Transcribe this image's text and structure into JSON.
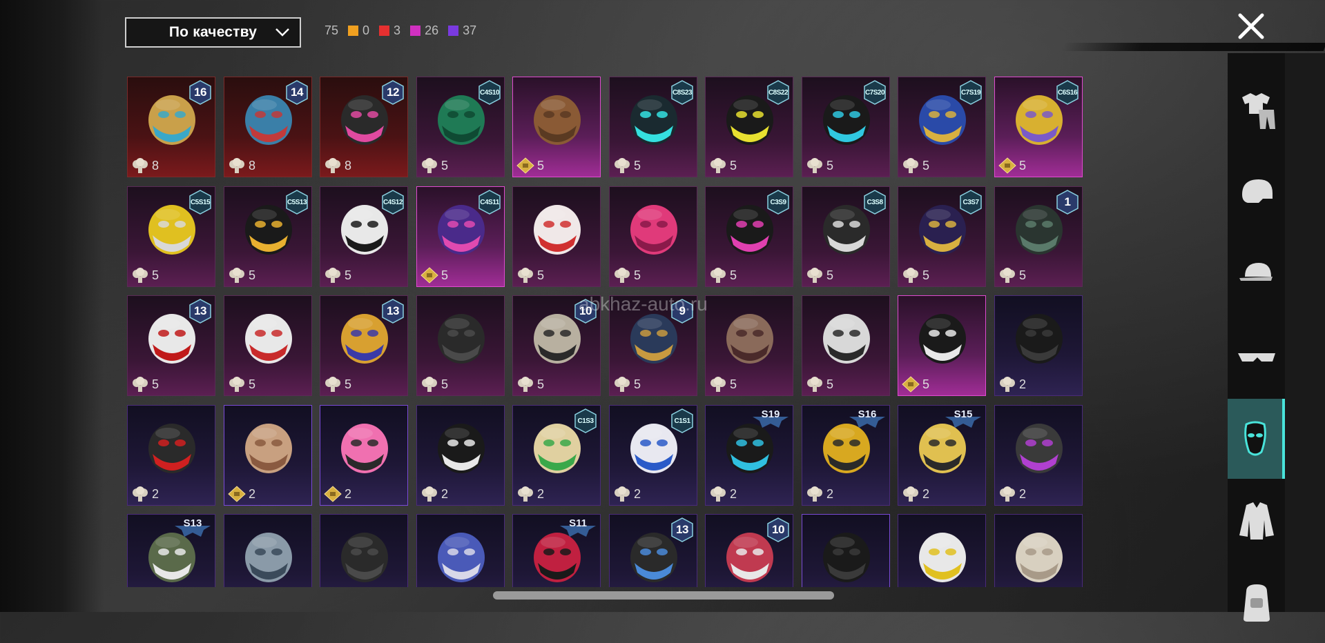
{
  "sort": {
    "label": "По качеству"
  },
  "counts": {
    "total": "75",
    "items": [
      {
        "color": "#f0a020",
        "value": "0"
      },
      {
        "color": "#e53030",
        "value": "3"
      },
      {
        "color": "#d030c0",
        "value": "26"
      },
      {
        "color": "#7a3ae0",
        "value": "37"
      }
    ]
  },
  "watermark": "abkhaz-auto.ru",
  "close_icon": "close-icon",
  "categories": [
    {
      "name": "outfit",
      "icon": "shirt-pants-icon"
    },
    {
      "name": "helmet",
      "icon": "helmet-icon"
    },
    {
      "name": "hat",
      "icon": "cap-icon"
    },
    {
      "name": "glasses",
      "icon": "glasses-icon"
    },
    {
      "name": "mask",
      "icon": "mask-icon",
      "active": true
    },
    {
      "name": "jacket",
      "icon": "jacket-icon"
    },
    {
      "name": "backpack",
      "icon": "backpack-icon"
    }
  ],
  "rows": [
    [
      {
        "q": "red",
        "badge": "16",
        "bt": "num",
        "price": "8",
        "cur": "bp",
        "art": "gold-blue-helmet-mask"
      },
      {
        "q": "red",
        "badge": "14",
        "bt": "num",
        "price": "8",
        "cur": "bp",
        "art": "blue-robot-mask"
      },
      {
        "q": "red",
        "badge": "12",
        "bt": "num",
        "price": "8",
        "cur": "bp",
        "art": "black-pink-mask"
      },
      {
        "q": "pink",
        "badge": "C4S10",
        "bt": "hex",
        "price": "5",
        "cur": "bp",
        "art": "green-face-mask"
      },
      {
        "q": "legendary",
        "badge": "",
        "bt": "",
        "price": "5",
        "cur": "ag",
        "art": "brown-bandana"
      },
      {
        "q": "pink",
        "badge": "C8S23",
        "bt": "hex",
        "price": "5",
        "cur": "bp",
        "art": "cyan-neon-mask"
      },
      {
        "q": "pink",
        "badge": "C8S22",
        "bt": "hex",
        "price": "5",
        "cur": "bp",
        "art": "black-yellow-mask"
      },
      {
        "q": "pink",
        "badge": "C7S20",
        "bt": "hex",
        "price": "5",
        "cur": "bp",
        "art": "black-cyan-mask"
      },
      {
        "q": "pink",
        "badge": "C7S19",
        "bt": "hex",
        "price": "5",
        "cur": "bp",
        "art": "blue-gold-mask"
      },
      {
        "q": "legendary",
        "badge": "C6S16",
        "bt": "hex",
        "price": "5",
        "cur": "ag",
        "art": "yellow-gas-mask"
      }
    ],
    [
      {
        "q": "pink",
        "badge": "C5S15",
        "bt": "hex",
        "price": "5",
        "cur": "bp",
        "art": "yellow-respirator"
      },
      {
        "q": "pink",
        "badge": "C5S13",
        "bt": "hex",
        "price": "5",
        "cur": "bp",
        "art": "graffiti-mask"
      },
      {
        "q": "pink",
        "badge": "C4S12",
        "bt": "hex",
        "price": "5",
        "cur": "bp",
        "art": "white-teeth-mask"
      },
      {
        "q": "legendary",
        "badge": "C4S11",
        "bt": "hex",
        "price": "5",
        "cur": "ag",
        "art": "purple-pink-mask"
      },
      {
        "q": "pink",
        "badge": "",
        "bt": "",
        "price": "5",
        "cur": "bp",
        "art": "kitsune-mask"
      },
      {
        "q": "pink",
        "badge": "",
        "bt": "",
        "price": "5",
        "cur": "bp",
        "art": "pink-visor"
      },
      {
        "q": "pink",
        "badge": "C3S9",
        "bt": "hex",
        "price": "5",
        "cur": "bp",
        "art": "black-pink-respirator"
      },
      {
        "q": "pink",
        "badge": "C3S8",
        "bt": "hex",
        "price": "5",
        "cur": "bp",
        "art": "black-white-respirator"
      },
      {
        "q": "pink",
        "badge": "C3S7",
        "bt": "hex",
        "price": "5",
        "cur": "bp",
        "art": "gold-chain-mask"
      },
      {
        "q": "pink",
        "badge": "1",
        "bt": "num",
        "price": "5",
        "cur": "bp",
        "art": "dark-skull-helmet"
      }
    ],
    [
      {
        "q": "pink",
        "badge": "13",
        "bt": "num",
        "price": "5",
        "cur": "bp",
        "art": "white-red-mask"
      },
      {
        "q": "pink",
        "badge": "",
        "bt": "",
        "price": "5",
        "cur": "bp",
        "art": "white-red-mouth-mask"
      },
      {
        "q": "pink",
        "badge": "13",
        "bt": "num",
        "price": "5",
        "cur": "bp",
        "art": "gold-respirator"
      },
      {
        "q": "pink",
        "badge": "",
        "bt": "",
        "price": "5",
        "cur": "bp",
        "art": "black-gas-mask"
      },
      {
        "q": "pink",
        "badge": "10",
        "bt": "num",
        "price": "5",
        "cur": "bp",
        "art": "skull-mask"
      },
      {
        "q": "pink",
        "badge": "9",
        "bt": "num",
        "price": "5",
        "cur": "bp",
        "art": "navy-gold-helmet"
      },
      {
        "q": "pink",
        "badge": "",
        "bt": "",
        "price": "5",
        "cur": "bp",
        "art": "plague-doctor-mask"
      },
      {
        "q": "pink",
        "badge": "",
        "bt": "",
        "price": "5",
        "cur": "bp",
        "art": "white-hood-mask"
      },
      {
        "q": "legendary",
        "badge": "",
        "bt": "",
        "price": "5",
        "cur": "ag",
        "art": "skull-bandana"
      },
      {
        "q": "purple",
        "badge": "",
        "bt": "",
        "price": "2",
        "cur": "bp",
        "art": "black-cloth-mask"
      }
    ],
    [
      {
        "q": "purple",
        "badge": "",
        "bt": "",
        "price": "2",
        "cur": "bp",
        "art": "red-eye-visor"
      },
      {
        "q": "purple hi",
        "badge": "",
        "bt": "",
        "price": "2",
        "cur": "ag",
        "art": "mammoth-mask"
      },
      {
        "q": "purple hi",
        "badge": "",
        "bt": "",
        "price": "2",
        "cur": "ag",
        "art": "pink-dino-mask"
      },
      {
        "q": "purple",
        "badge": "",
        "bt": "",
        "price": "2",
        "cur": "bp",
        "art": "black-smile-mask"
      },
      {
        "q": "purple",
        "badge": "C1S3",
        "bt": "hex",
        "price": "2",
        "cur": "bp",
        "art": "green-cactus-mask"
      },
      {
        "q": "purple",
        "badge": "C1S1",
        "bt": "hex",
        "price": "2",
        "cur": "bp",
        "art": "blue-white-mask"
      },
      {
        "q": "purple",
        "badge": "S19",
        "bt": "s",
        "price": "2",
        "cur": "bp",
        "art": "cyan-visor-mask"
      },
      {
        "q": "purple",
        "badge": "S16",
        "bt": "s",
        "price": "2",
        "cur": "bp",
        "art": "gold-spike-mask"
      },
      {
        "q": "purple",
        "badge": "S15",
        "bt": "s",
        "price": "2",
        "cur": "bp",
        "art": "gold-skull-mask"
      },
      {
        "q": "purple",
        "badge": "",
        "bt": "",
        "price": "2",
        "cur": "bp",
        "art": "purple-helmet"
      }
    ],
    [
      {
        "q": "purple",
        "badge": "S13",
        "bt": "s",
        "price": "",
        "cur": "",
        "art": "goggle-helmet"
      },
      {
        "q": "purple",
        "badge": "",
        "bt": "",
        "price": "",
        "cur": "",
        "art": "silver-helmet"
      },
      {
        "q": "purple",
        "badge": "",
        "bt": "",
        "price": "",
        "cur": "",
        "art": "black-neck-gaiter"
      },
      {
        "q": "purple",
        "badge": "",
        "bt": "",
        "price": "",
        "cur": "",
        "art": "blue-skull-mask"
      },
      {
        "q": "purple",
        "badge": "S11",
        "bt": "s",
        "price": "",
        "cur": "",
        "art": "red-mouth-mask"
      },
      {
        "q": "purple",
        "badge": "13",
        "bt": "num",
        "price": "",
        "cur": "",
        "art": "black-respirator"
      },
      {
        "q": "purple",
        "badge": "10",
        "bt": "num",
        "price": "",
        "cur": "",
        "art": "red-teeth-mask"
      },
      {
        "q": "purple hi",
        "badge": "",
        "bt": "",
        "price": "",
        "cur": "",
        "art": "ninja-hood"
      },
      {
        "q": "purple",
        "badge": "",
        "bt": "",
        "price": "",
        "cur": "",
        "art": "yellow-stripe-helmet"
      },
      {
        "q": "purple",
        "badge": "",
        "bt": "",
        "price": "",
        "cur": "",
        "art": "mummy-mask"
      }
    ]
  ]
}
